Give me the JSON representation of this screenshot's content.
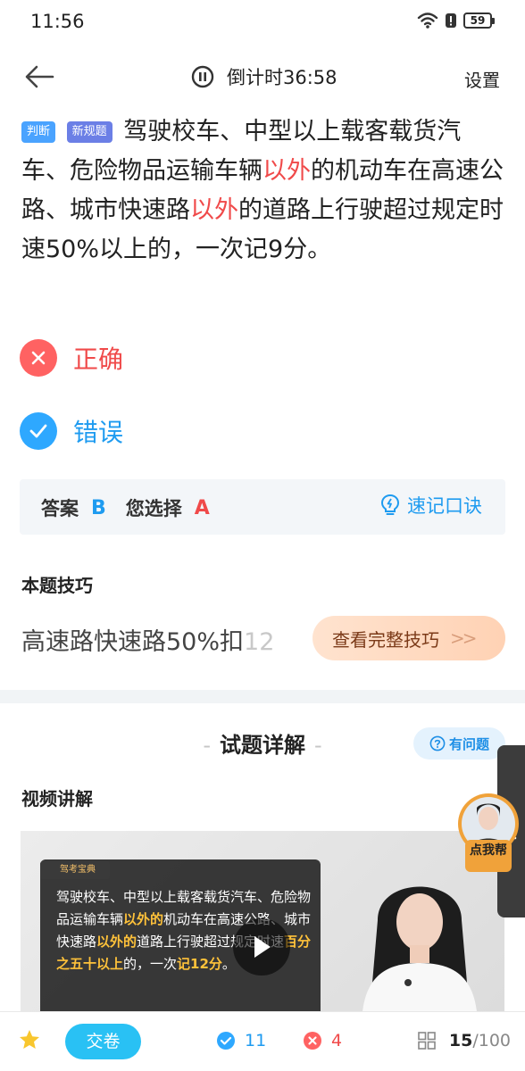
{
  "status_bar": {
    "time": "11:56",
    "battery": "59"
  },
  "nav": {
    "timer_label": "倒计时36:58",
    "settings_label": "设置"
  },
  "question": {
    "tag_type": "判断",
    "tag_new": "新规题",
    "text_1": "驾驶校车、中型以上载客载货汽车、危险物品运输车辆",
    "highlight_1": "以外",
    "text_2": "的机动车在高速公路、城市快速路",
    "highlight_2": "以外",
    "text_3": "的道路上行驶超过规定时速50%以上的，一次记9分。"
  },
  "options": [
    {
      "label": "正确"
    },
    {
      "label": "错误"
    }
  ],
  "answer": {
    "answer_label": "答案",
    "answer_value": "B",
    "chosen_label": "您选择",
    "chosen_value": "A",
    "memo_label": "速记口诀"
  },
  "tip": {
    "title": "本题技巧",
    "text_main": "高速路快速路50%扣",
    "text_faded": "12",
    "button_label": "查看完整技巧"
  },
  "explanation": {
    "title": "试题详解",
    "have_question_label": "有问题",
    "video_title": "视频讲解",
    "video_brand": "驾考宝典",
    "video_text_1": "驾驶校车、中型以上载客载货汽车、危险物品运输车辆",
    "video_hl_1": "以外的",
    "video_text_2": "机动车在高速公路、城市快速路",
    "video_hl_2": "以外的",
    "video_text_3": "道路上行驶超过规定时速",
    "video_hl_3": "百分之五十以上",
    "video_text_4": "的，一次",
    "video_hl_4": "记12分",
    "video_text_5": "。",
    "helper_label": "点我帮"
  },
  "bottom_bar": {
    "submit_label": "交卷",
    "correct_count": "11",
    "wrong_count": "4",
    "current": "15",
    "total": "/100"
  },
  "colors": {
    "accent_blue": "#1e9bf0",
    "accent_red": "#f04a4a",
    "submit_bg": "#29c1f4"
  }
}
